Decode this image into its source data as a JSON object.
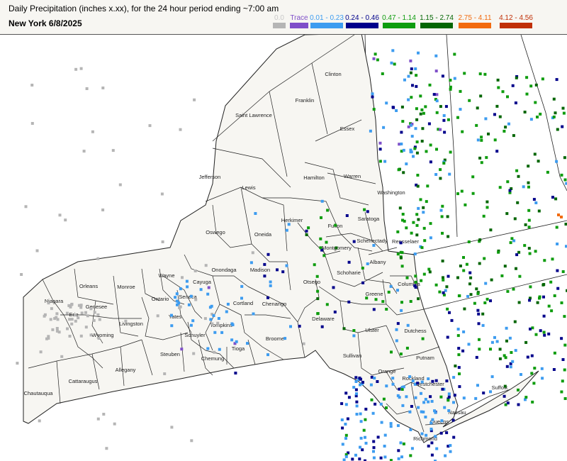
{
  "header": {
    "title": "Daily Precipitation (inches  x.xx),  for the 24 hour period ending ~7:00 am",
    "subtitle": "New York 6/8/2025"
  },
  "legend": [
    {
      "label": "0.0",
      "color": "#b5b5b5",
      "text_color": "#c8c8c8"
    },
    {
      "label": "Trace",
      "color": "#7f4fc9",
      "text_color": "#7f4fc9"
    },
    {
      "label": "0.01 - 0.23",
      "color": "#3d9cf0",
      "text_color": "#3d9cf0"
    },
    {
      "label": "0.24 - 0.46",
      "color": "#00008b",
      "text_color": "#00008b"
    },
    {
      "label": "0.47 - 1.14",
      "color": "#0e9c0e",
      "text_color": "#0e9c0e"
    },
    {
      "label": "1.15 - 2.74",
      "color": "#046604",
      "text_color": "#046604"
    },
    {
      "label": "2.75 - 4.11",
      "color": "#f26b0f",
      "text_color": "#f26b0f"
    },
    {
      "label": "4.12 - 4.56",
      "color": "#c03008",
      "text_color": "#c03008"
    }
  ],
  "map": {
    "state_fill": "#f7f6f2",
    "border_color": "#222222",
    "counties": [
      "Clinton",
      "Franklin",
      "Saint Lawrence",
      "Essex",
      "Jefferson",
      "Lewis",
      "Hamilton",
      "Warren",
      "Washington",
      "Oswego",
      "Oneida",
      "Herkimer",
      "Fulton",
      "Saratoga",
      "Niagara",
      "Orleans",
      "Monroe",
      "Wayne",
      "Cayuga",
      "Onondaga",
      "Madison",
      "Montgomery",
      "Schenectady",
      "Rensselaer",
      "Albany",
      "Genesee",
      "Erie",
      "Wyoming",
      "Livingston",
      "Ontario",
      "Seneca",
      "Yates",
      "Schuyler",
      "Tompkins",
      "Cortland",
      "Chenango",
      "Otsego",
      "Schoharie",
      "Greene",
      "Columbia",
      "Delaware",
      "Ulster",
      "Dutchess",
      "Chautauqua",
      "Cattaraugus",
      "Allegany",
      "Steuben",
      "Chemung",
      "Tioga",
      "Broome",
      "Sullivan",
      "Orange",
      "Putnam",
      "Rockland",
      "Westchester",
      "Nassau",
      "Queens",
      "Richmond",
      "Suffolk"
    ]
  }
}
